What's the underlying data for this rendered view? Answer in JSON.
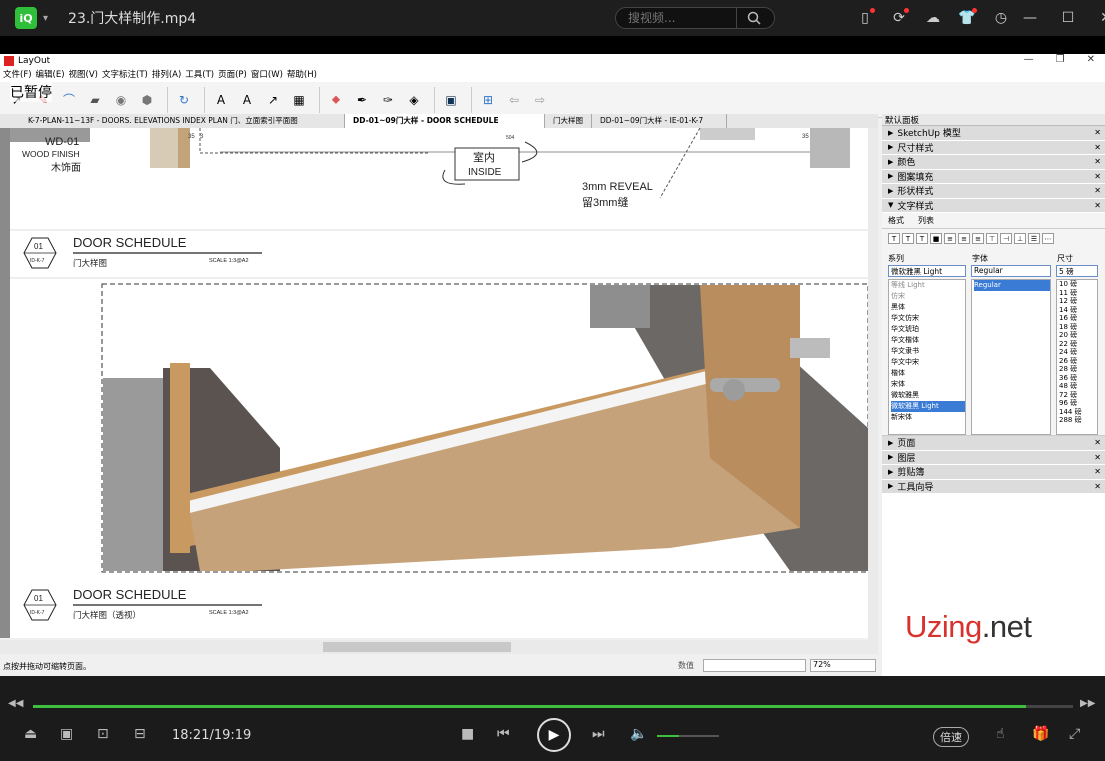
{
  "player": {
    "logo_text": "iQ",
    "file_title": "23.门大样制作.mp4",
    "search_placeholder": "搜视频...",
    "time": "18:21/19:19",
    "speed_label": "倍速",
    "progress": 0.955,
    "volume": 0.35,
    "paused_overlay": "已暂停"
  },
  "app": {
    "title": "LayOut",
    "menus": [
      "文件(F)",
      "编辑(E)",
      "视图(V)",
      "文字标注(T)",
      "排列(A)",
      "工具(T)",
      "页面(P)",
      "窗口(W)",
      "帮助(H)"
    ],
    "tabs": [
      {
        "label": "K-7-PLAN-11~13F - DOORS. ELEVATIONS INDEX PLAN 门、立面索引平面图",
        "active": false
      },
      {
        "label": "DD-01~09门大样 - DOOR  SCHEDULE",
        "active": true
      },
      {
        "label": "门大样图",
        "active": false
      },
      {
        "label": "DD-01~09门大样 - IE-01-K-7",
        "active": false
      }
    ],
    "status_hint": "点按并拖动可缩转页面。",
    "measure_label": "数值",
    "zoom": "72%"
  },
  "drawing": {
    "wd_code": "WD-01",
    "wood_finish": "WOOD FINISH",
    "wood_cn": "木饰面",
    "inside_cn": "室内",
    "inside_en": "INSIDE",
    "reveal_en": "3mm REVEAL",
    "reveal_cn": "留3mm缝",
    "dim_3": "3",
    "dim_35a": "35",
    "dim_35b": "35",
    "dim_504": "504",
    "title1_num": "01",
    "title1_ref": "ID-K-7",
    "title1_en": "DOOR SCHEDULE",
    "title1_cn": "门大样图",
    "title1_scale": "SCALE 1:3@A2",
    "title2_num": "01",
    "title2_ref": "ID-K-7",
    "title2_en": "DOOR SCHEDULE",
    "title2_cn": "门大样图（透视）",
    "title2_scale": "SCALE 1:3@A2"
  },
  "panel": {
    "title": "默认面板",
    "sections_top": [
      "SketchUp 模型",
      "尺寸样式",
      "颜色",
      "图案填充",
      "形状样式",
      "文字样式"
    ],
    "text_tabs": [
      "格式",
      "列表"
    ],
    "family_label": "系列",
    "style_label": "字体",
    "size_label": "尺寸",
    "family_value": "微软雅黑 Light",
    "style_value": "Regular",
    "size_value": "5 磅",
    "families": [
      "等线 Light",
      "仿宋",
      "黑体",
      "华文仿宋",
      "华文琥珀",
      "华文楷体",
      "华文隶书",
      "华文中宋",
      "楷体",
      "宋体",
      "微软雅黑",
      "微软雅黑 Light",
      "新宋体"
    ],
    "styles": [
      "Regular"
    ],
    "sizes": [
      "10 磅",
      "11 磅",
      "12 磅",
      "14 磅",
      "16 磅",
      "18 磅",
      "20 磅",
      "22 磅",
      "24 磅",
      "26 磅",
      "28 磅",
      "36 磅",
      "48 磅",
      "72 磅",
      "96 磅",
      "144 磅",
      "288 磅"
    ],
    "sections_bottom": [
      "页面",
      "图层",
      "剪贴簿",
      "工具向导"
    ]
  },
  "watermark": {
    "part1": "Uzing",
    "part2": ".net"
  }
}
